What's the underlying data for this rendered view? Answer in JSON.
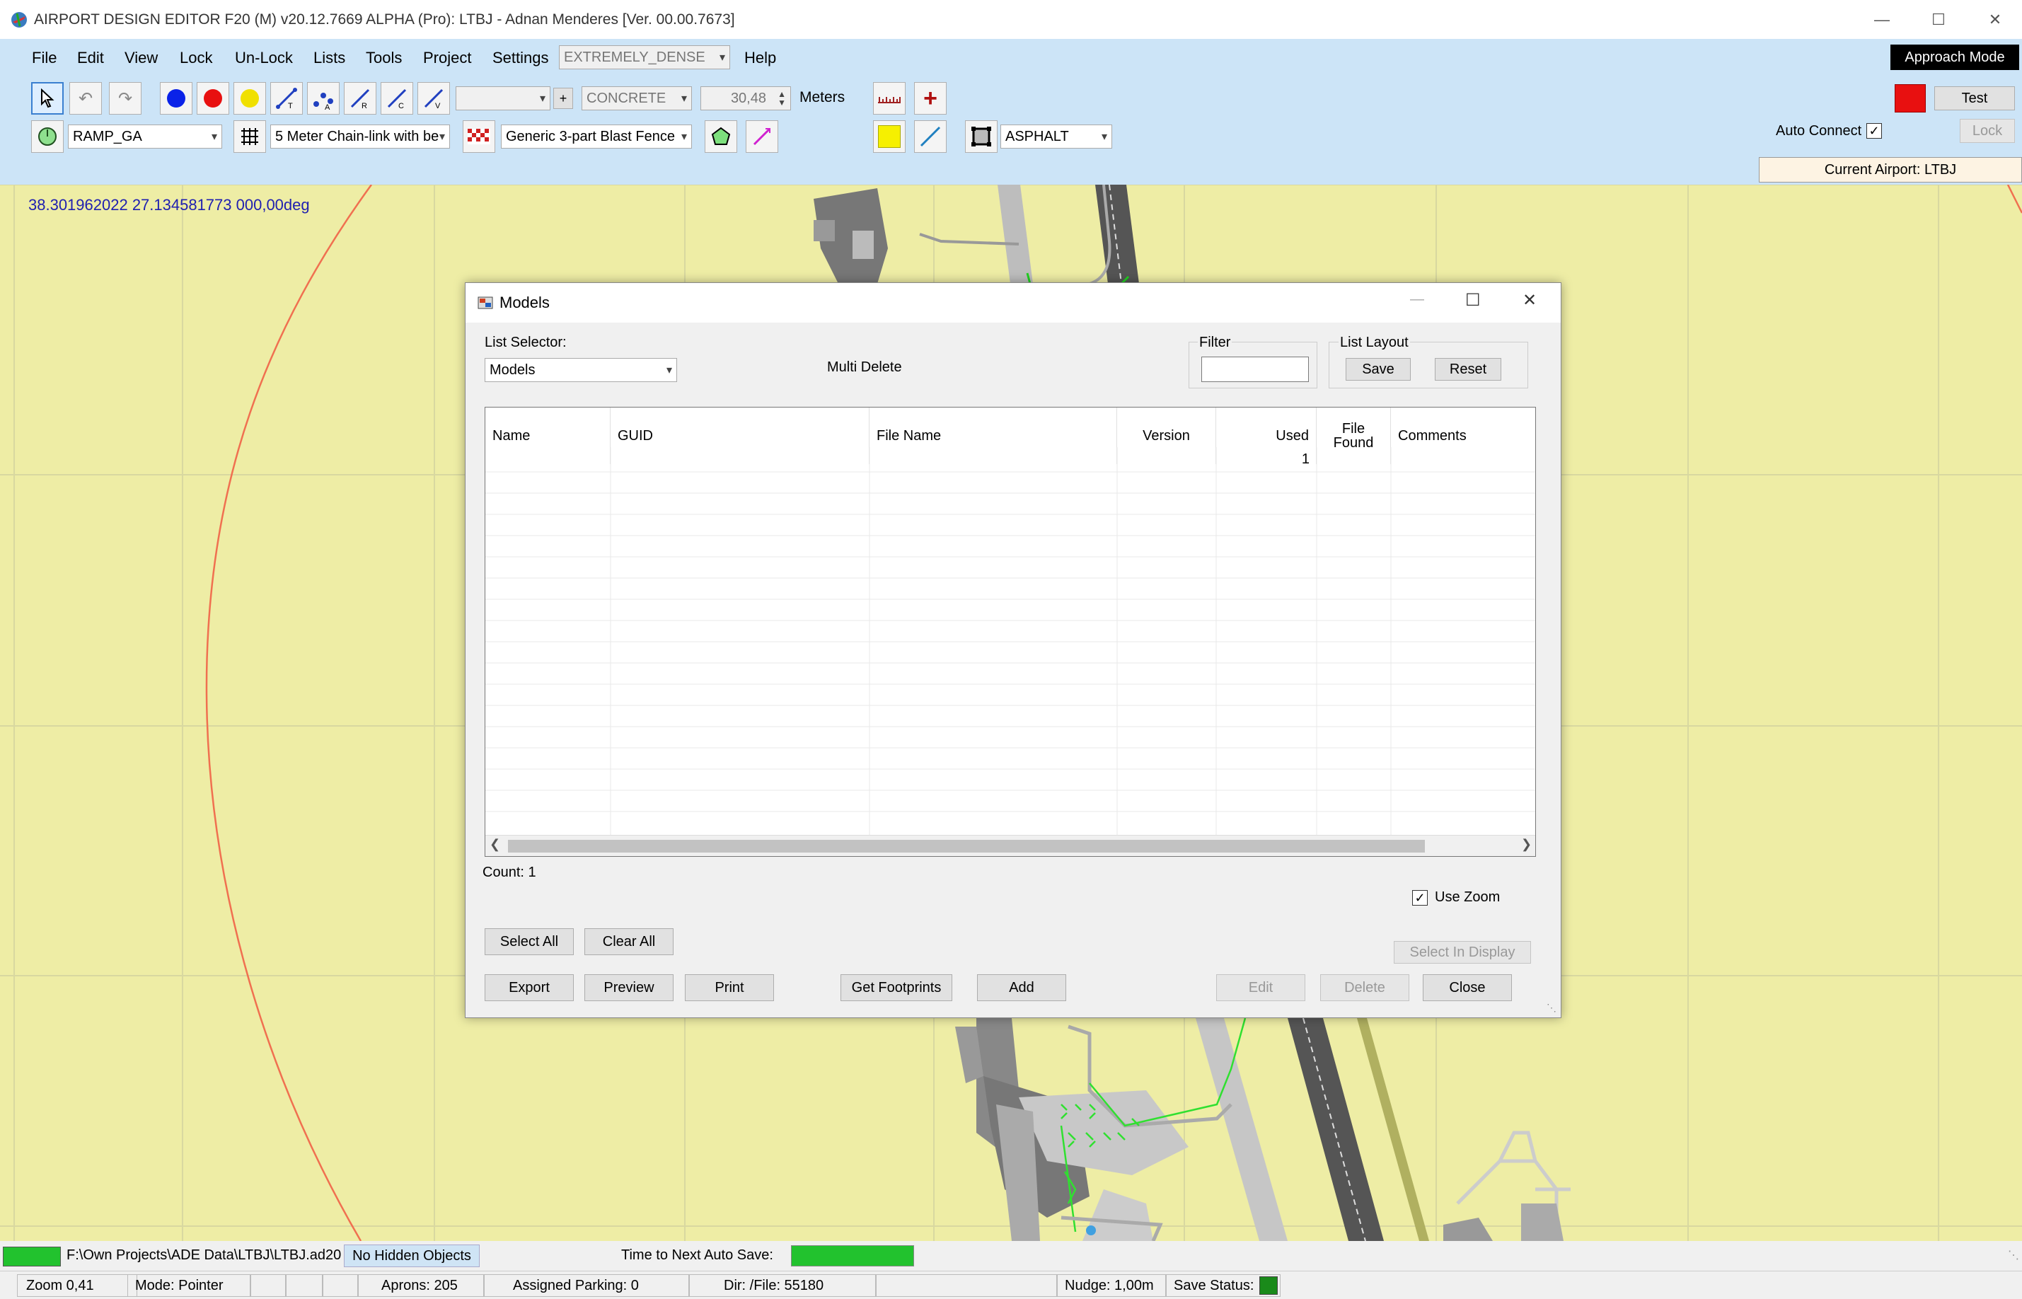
{
  "window": {
    "title": "AIRPORT DESIGN EDITOR F20 (M)  v20.12.7669 ALPHA (Pro): LTBJ - Adnan Menderes [Ver. 00.00.7673]"
  },
  "menu": {
    "items": [
      "File",
      "Edit",
      "View",
      "Lock",
      "Un-Lock",
      "Lists",
      "Tools",
      "Project",
      "Settings",
      "Help"
    ],
    "density": "EXTREMELY_DENSE",
    "approach_mode": "Approach Mode"
  },
  "toolbar": {
    "surface_combo_1": "",
    "plus": "+",
    "surface_concrete": "CONCRETE",
    "width_value": "30,48",
    "units": "Meters",
    "test_label": "Test",
    "ramp_combo": "RAMP_GA",
    "fence_combo": "5 Meter Chain-link with be",
    "blast_combo": "Generic 3-part Blast Fence",
    "asphalt_combo": "ASPHALT",
    "auto_connect": "Auto Connect",
    "auto_connect_checked": true,
    "lock_label": "Lock",
    "current_airport": "Current Airport: LTBJ",
    "icons": [
      "pointer-icon",
      "undo-icon",
      "redo-icon",
      "blue-circle-icon",
      "red-circle-icon",
      "yellow-circle-icon",
      "taxi-line-icon",
      "apron-line-icon",
      "runway-line-icon",
      "custom-line-icon",
      "vehicle-line-icon",
      "ruler-icon",
      "crosshair-icon",
      "red-square-icon",
      "ramp-start-icon",
      "fence-icon",
      "blast-fence-icon",
      "polygon-icon",
      "line-tool-icon",
      "yellow-square-icon",
      "diagonal-line-icon",
      "aprons-icon"
    ]
  },
  "map": {
    "coords": "38.301962022   27.134581773 000,00deg"
  },
  "dialog": {
    "title": "Models",
    "list_selector_label": "List Selector:",
    "list_selector_value": "Models",
    "multi_delete": "Multi Delete",
    "filter_label": "Filter",
    "filter_value": "",
    "list_layout_label": "List Layout",
    "save": "Save",
    "reset": "Reset",
    "columns": [
      "Name",
      "GUID",
      "File Name",
      "Version",
      "Used",
      "File Found",
      "Comments"
    ],
    "rows": [
      {
        "name": "",
        "guid": "",
        "file_name": "",
        "version": "",
        "used": "1",
        "file_found": "",
        "comments": ""
      }
    ],
    "count": "Count: 1",
    "use_zoom": "Use Zoom",
    "use_zoom_checked": true,
    "select_all": "Select All",
    "clear_all": "Clear All",
    "select_in_display": "Select In Display",
    "export": "Export",
    "preview": "Preview",
    "print": "Print",
    "get_footprints": "Get Footprints",
    "add": "Add",
    "edit": "Edit",
    "delete": "Delete",
    "close": "Close"
  },
  "status": {
    "file_path": "F:\\Own Projects\\ADE Data\\LTBJ\\LTBJ.ad20",
    "hidden_objects": "No Hidden Objects",
    "auto_save_label": "Time to Next Auto Save:",
    "zoom": "Zoom 0,41",
    "mode": "Mode: Pointer",
    "aprons": "Aprons: 205",
    "assigned_parking": "Assigned Parking: 0",
    "dir_file": "Dir: /File: 55180",
    "nudge": "Nudge: 1,00m",
    "save_status": "Save Status:"
  },
  "colors": {
    "menubar_bg": "#cce4f7",
    "map_bg": "#eeeda5",
    "status_green": "#22c22e",
    "save_status_green": "#1a8a1a"
  }
}
